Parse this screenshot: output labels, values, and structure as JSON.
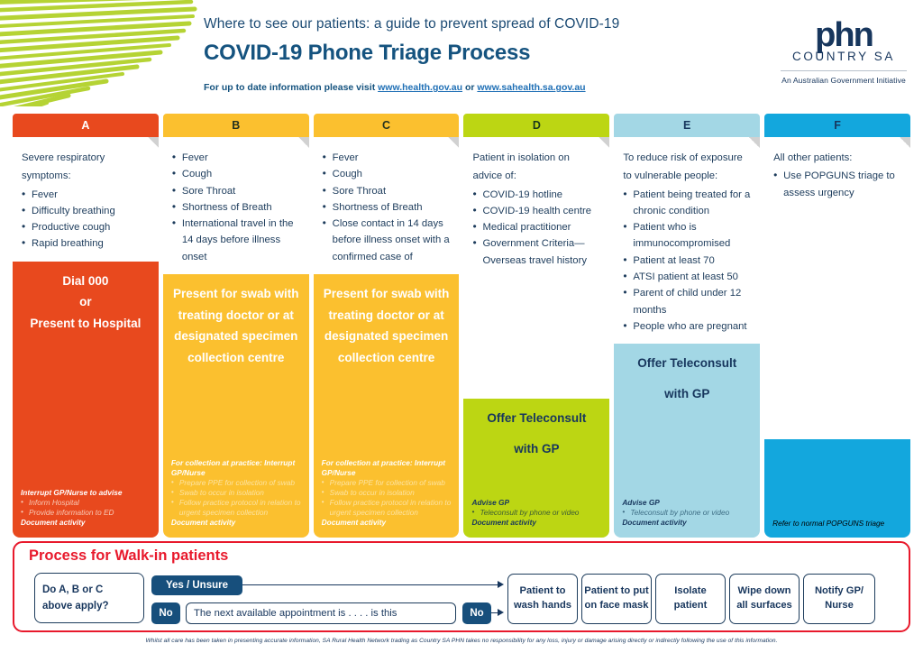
{
  "header": {
    "tagline_bold": "Where to see our patients",
    "tagline_rest": ": a guide to prevent spread of COVID-19",
    "title": "COVID-19 Phone Triage Process",
    "subline_prefix": "For up to date information please visit ",
    "link1": "www.health.gov.au",
    "subline_mid": "  or  ",
    "link2": "www.sahealth.sa.gov.au"
  },
  "logo": {
    "mark": "phn",
    "region": "COUNTRY SA",
    "tagline": "An Australian Government Initiative"
  },
  "colors": {
    "col_a": "#e8491e",
    "col_b": "#fbc02f",
    "col_c": "#fbc02f",
    "col_d": "#bcd613",
    "col_e": "#a3d7e5",
    "col_f": "#13a7dd",
    "red_panel": "#e8192c",
    "navy": "#17365d"
  },
  "columns": [
    {
      "letter": "A",
      "lead": [
        "Severe respiratory",
        "symptoms:"
      ],
      "criteria": [
        "Fever",
        "Difficulty breathing",
        "Productive cough",
        "Rapid breathing"
      ],
      "action": [
        "Dial 000",
        "or",
        "Present to Hospital"
      ],
      "notes_title": "Interrupt GP/Nurse to advise",
      "notes": [
        "Inform Hospital",
        "Provide information to ED"
      ],
      "notes_footer": "Document activity"
    },
    {
      "letter": "B",
      "lead": [],
      "criteria": [
        "Fever",
        "Cough",
        "Sore Throat",
        "Shortness of Breath",
        "International travel in the 14 days before illness onset"
      ],
      "action": [
        "Present for swab with treating doctor or at designated specimen collection centre"
      ],
      "notes_title": "For collection at practice: Interrupt GP/Nurse",
      "notes": [
        "Prepare PPE for collection of swab",
        "Swab to occur in isolation",
        "Follow practice protocol in relation to urgent specimen collection"
      ],
      "notes_footer": "Document activity"
    },
    {
      "letter": "C",
      "lead": [],
      "criteria": [
        "Fever",
        "Cough",
        "Sore Throat",
        "Shortness of Breath",
        "Close contact in 14 days before illness onset with a confirmed case of"
      ],
      "action": [
        "Present for swab with treating doctor or at designated specimen collection centre"
      ],
      "notes_title": "For collection at practice: Interrupt GP/Nurse",
      "notes": [
        "Prepare PPE for collection of swab",
        "Swab to occur in isolation",
        "Follow practice protocol in relation to urgent specimen collection"
      ],
      "notes_footer": "Document activity"
    },
    {
      "letter": "D",
      "lead": [
        "Patient in isolation on",
        "advice of:"
      ],
      "criteria": [
        "COVID-19 hotline",
        "COVID-19 health centre",
        "Medical practitioner",
        "Government Criteria—Overseas travel history"
      ],
      "action": [
        "Offer Teleconsult",
        "with GP"
      ],
      "notes_title": "Advise GP",
      "notes": [
        "Teleconsult by phone or video"
      ],
      "notes_footer": "Document activity"
    },
    {
      "letter": "E",
      "lead": [
        "To reduce risk of exposure",
        "to vulnerable people:"
      ],
      "criteria": [
        "Patient being treated for a chronic condition",
        "Patient who is immunocompromised",
        "Patient at least 70",
        "ATSI patient at least 50",
        "Parent of child under 12 months",
        "People who are pregnant"
      ],
      "action": [
        "Offer Teleconsult",
        "with GP"
      ],
      "notes_title": "Advise GP",
      "notes": [
        "Teleconsult by phone or video"
      ],
      "notes_footer": "Document activity"
    },
    {
      "letter": "F",
      "lead": [
        "All other patients:"
      ],
      "criteria": [
        "Use POPGUNS triage to assess urgency"
      ],
      "action": [],
      "notes_title": "",
      "notes": [],
      "notes_footer": "Refer to normal POPGUNS triage"
    }
  ],
  "walkin": {
    "title": "Process for Walk-in patients",
    "question_line1": "Do A, B or C",
    "question_line2": "above apply?",
    "yes_label": "Yes / Unsure",
    "no_label_1": "No",
    "appointment_text": "The next available appointment is . . . . is this",
    "no_label_2": "No",
    "steps": [
      "Patient to wash hands",
      "Patient to put on face mask",
      "Isolate patient",
      "Wipe down all surfaces",
      "Notify GP/ Nurse"
    ]
  },
  "footer": {
    "disclaimer": "Whilst all care has been taken in presenting accurate information, SA Rural Health Network trading as Country SA PHN takes no responsibility for any loss, injury or damage arising directly or indirectly following the use of this information."
  }
}
